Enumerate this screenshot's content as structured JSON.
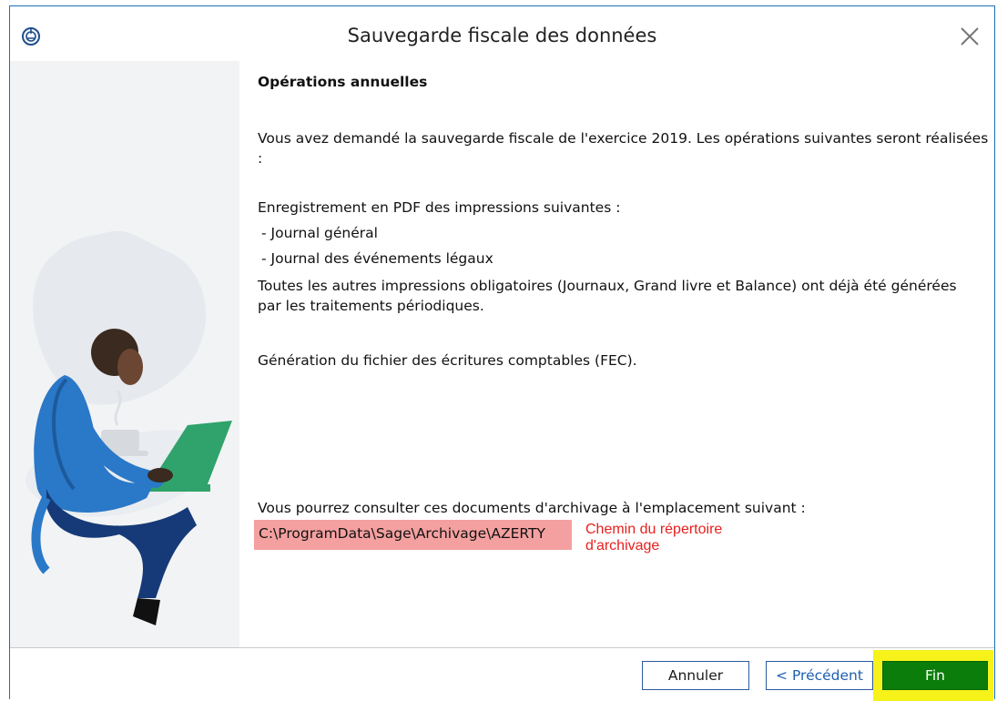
{
  "window": {
    "title": "Sauvegarde fiscale des données"
  },
  "content": {
    "heading": "Opérations annuelles",
    "intro_line1": "Vous avez demandé la sauvegarde fiscale de l'exercice 2019. Les opérations suivantes seront réalisées",
    "intro_line2": ":",
    "pdf_intro": "Enregistrement en PDF des impressions suivantes :",
    "pdf_items": [
      "- Journal général",
      "- Journal des événements légaux"
    ],
    "other_prints_line1": "Toutes les autres impressions obligatoires (Journaux, Grand livre et Balance) ont déjà été générées",
    "other_prints_line2": "par les traitements périodiques.",
    "fec": "Génération du fichier des écritures comptables (FEC).",
    "archive_intro": "Vous pourrez consulter ces documents d'archivage à l'emplacement suivant :",
    "archive_path": "C:\\ProgramData\\Sage\\Archivage\\AZERTY"
  },
  "annotation": {
    "line1": "Chemin du répertoire",
    "line2": "d'archivage",
    "color": "#e8201e"
  },
  "footer": {
    "cancel_label": "Annuler",
    "prev_label": "< Précédent",
    "finish_label": "Fin"
  },
  "colors": {
    "finish_button": "#0a7d0a",
    "highlight": "#f6f21a",
    "path_highlight": "#f4a0a0",
    "border": "#1f6fbf"
  },
  "icons": [
    "app-icon",
    "close-icon",
    "person-laptop-illustration"
  ]
}
